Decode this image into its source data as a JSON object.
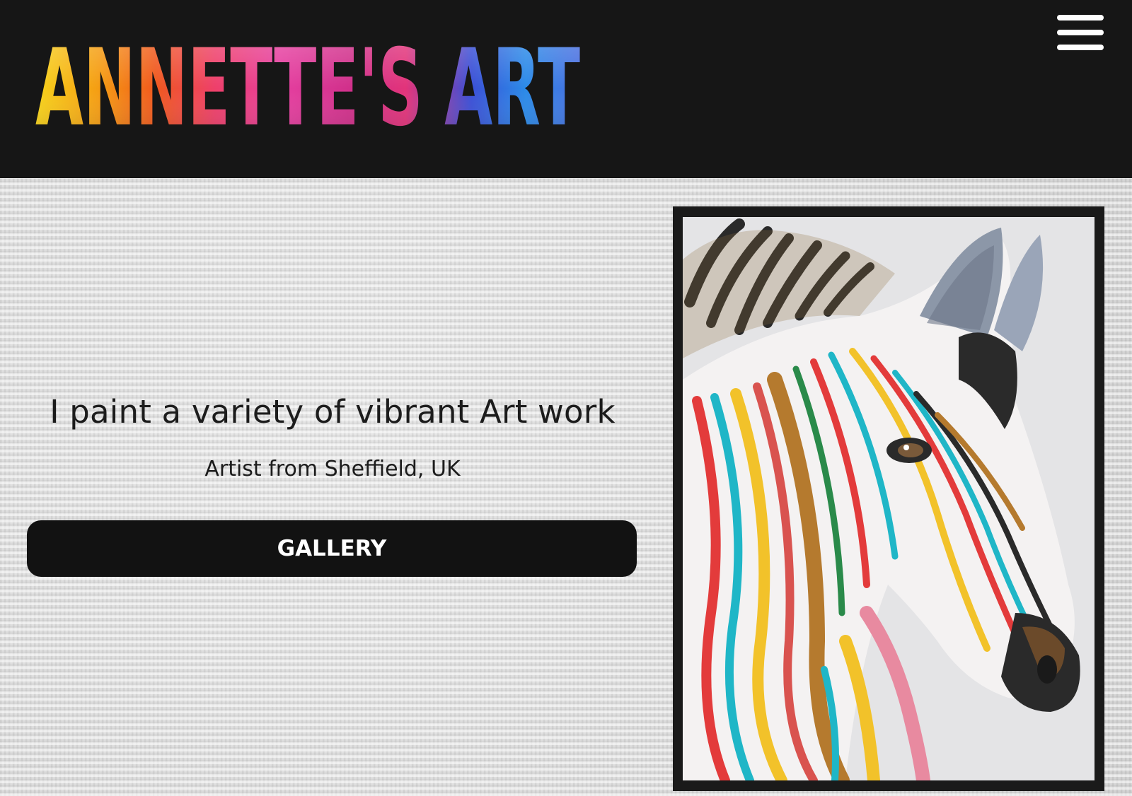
{
  "header": {
    "logo_text": "ANNETTE'S ART",
    "menu_icon": "hamburger-menu-icon"
  },
  "hero": {
    "headline": "I paint a variety of vibrant Art work",
    "subheadline": "Artist from Sheffield, UK",
    "gallery_button_label": "GALLERY"
  },
  "artwork": {
    "subject": "rainbow-striped zebra painting"
  },
  "colors": {
    "header_bg": "#161616",
    "button_bg": "#121212",
    "frame": "#1a1a1a"
  }
}
